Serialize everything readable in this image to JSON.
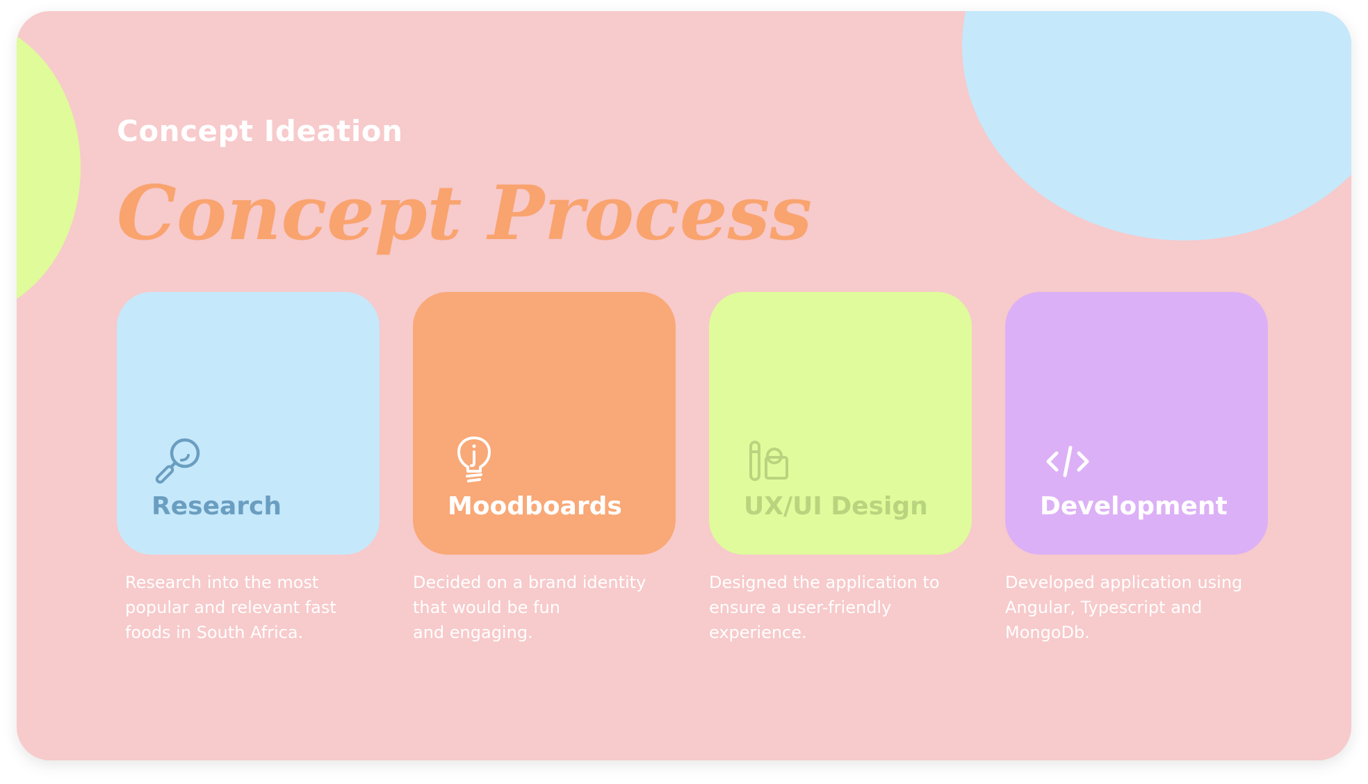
{
  "colors": {
    "background": "#f7cacb",
    "blob_green": "#dffb9a",
    "blob_blue": "#c5e8fb",
    "title": "#f9a36f",
    "eyebrow": "#ffffff",
    "description": "#ffffff"
  },
  "header": {
    "eyebrow": "Concept Ideation",
    "title": "Concept Process"
  },
  "cards": [
    {
      "label": "Research",
      "icon": "magnifier-icon",
      "card_color": "#c6e8fb",
      "accent_color": "#6a9ec0",
      "description": "Research into the most\npopular and relevant fast\nfoods in South Africa."
    },
    {
      "label": "Moodboards",
      "icon": "lightbulb-icon",
      "card_color": "#f9a877",
      "accent_color": "#ffffff",
      "description": "Decided on a brand identity\nthat would be fun\nand engaging."
    },
    {
      "label": "UX/UI Design",
      "icon": "design-tools-icon",
      "card_color": "#e0fb9b",
      "accent_color": "#b9d47f",
      "description": "Designed the application to\nensure a user-friendly\nexperience."
    },
    {
      "label": "Development",
      "icon": "code-icon",
      "card_color": "#dcb0f6",
      "accent_color": "#ffffff",
      "description": "Developed application using\nAngular, Typescript and\nMongoDb."
    }
  ]
}
